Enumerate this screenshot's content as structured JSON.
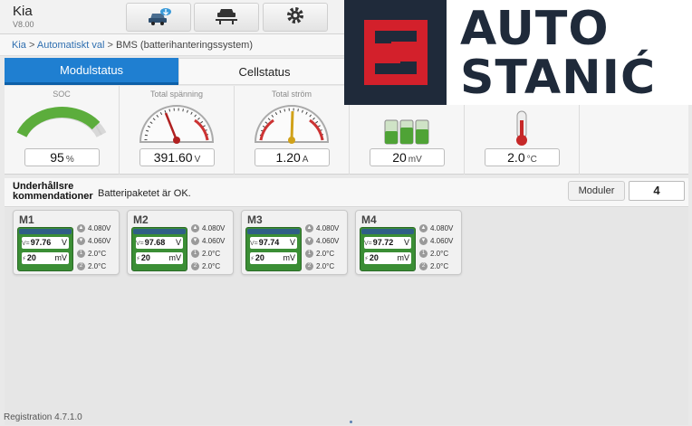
{
  "header": {
    "make": "Kia",
    "version": "V8.00",
    "icons": [
      "vehicle-cloud-icon",
      "lift-icon",
      "settings-gear-icon"
    ]
  },
  "breadcrumb": {
    "items": [
      "Kia",
      "Automatiskt val",
      "BMS (batterihanteringssystem)"
    ],
    "sep": ">"
  },
  "tabs": [
    {
      "label": "Modulstatus",
      "active": true
    },
    {
      "label": "Cellstatus",
      "active": false
    }
  ],
  "gauges": [
    {
      "label": "SOC",
      "value": "95",
      "unit": "%",
      "icon": "soc-arc-gauge-icon",
      "level": 0.95
    },
    {
      "label": "Total spänning",
      "value": "391.60",
      "unit": "V",
      "icon": "voltage-dial-icon"
    },
    {
      "label": "Total ström",
      "value": "1.20",
      "unit": "A",
      "icon": "current-dial-icon"
    },
    {
      "label": "",
      "value": "20",
      "unit": "mV",
      "icon": "cell-balance-icon"
    },
    {
      "label": "",
      "value": "2.0",
      "unit": "°C",
      "icon": "thermometer-icon"
    }
  ],
  "maintenance": {
    "label_line1": "Underhållsre",
    "label_line2": "kommendationer",
    "message": "Batteripaketet är OK.",
    "modules_label": "Moduler",
    "modules_count": "4"
  },
  "modules": [
    {
      "name": "M1",
      "voltage": "97.76",
      "voltage_unit": "V",
      "delta": "20",
      "delta_unit": "mV",
      "max_cell": "4.080V",
      "min_cell": "4.060V",
      "temp1": "2.0°C",
      "temp2": "2.0°C"
    },
    {
      "name": "M2",
      "voltage": "97.68",
      "voltage_unit": "V",
      "delta": "20",
      "delta_unit": "mV",
      "max_cell": "4.080V",
      "min_cell": "4.060V",
      "temp1": "2.0°C",
      "temp2": "2.0°C"
    },
    {
      "name": "M3",
      "voltage": "97.74",
      "voltage_unit": "V",
      "delta": "20",
      "delta_unit": "mV",
      "max_cell": "4.080V",
      "min_cell": "4.060V",
      "temp1": "2.0°C",
      "temp2": "2.0°C"
    },
    {
      "name": "M4",
      "voltage": "97.72",
      "voltage_unit": "V",
      "delta": "20",
      "delta_unit": "mV",
      "max_cell": "4.080V",
      "min_cell": "4.060V",
      "temp1": "2.0°C",
      "temp2": "2.0°C"
    }
  ],
  "footer": {
    "registration": "Registration 4.7.1.0"
  },
  "logo": {
    "line1": "AUTO",
    "line2": "STANIĆ",
    "color": "#1f2a3a",
    "accent": "#d3202b"
  },
  "colors": {
    "tab_active": "#1f7fd1",
    "battery_green": "#3b8e35",
    "gauge_needle": "#b02020"
  }
}
